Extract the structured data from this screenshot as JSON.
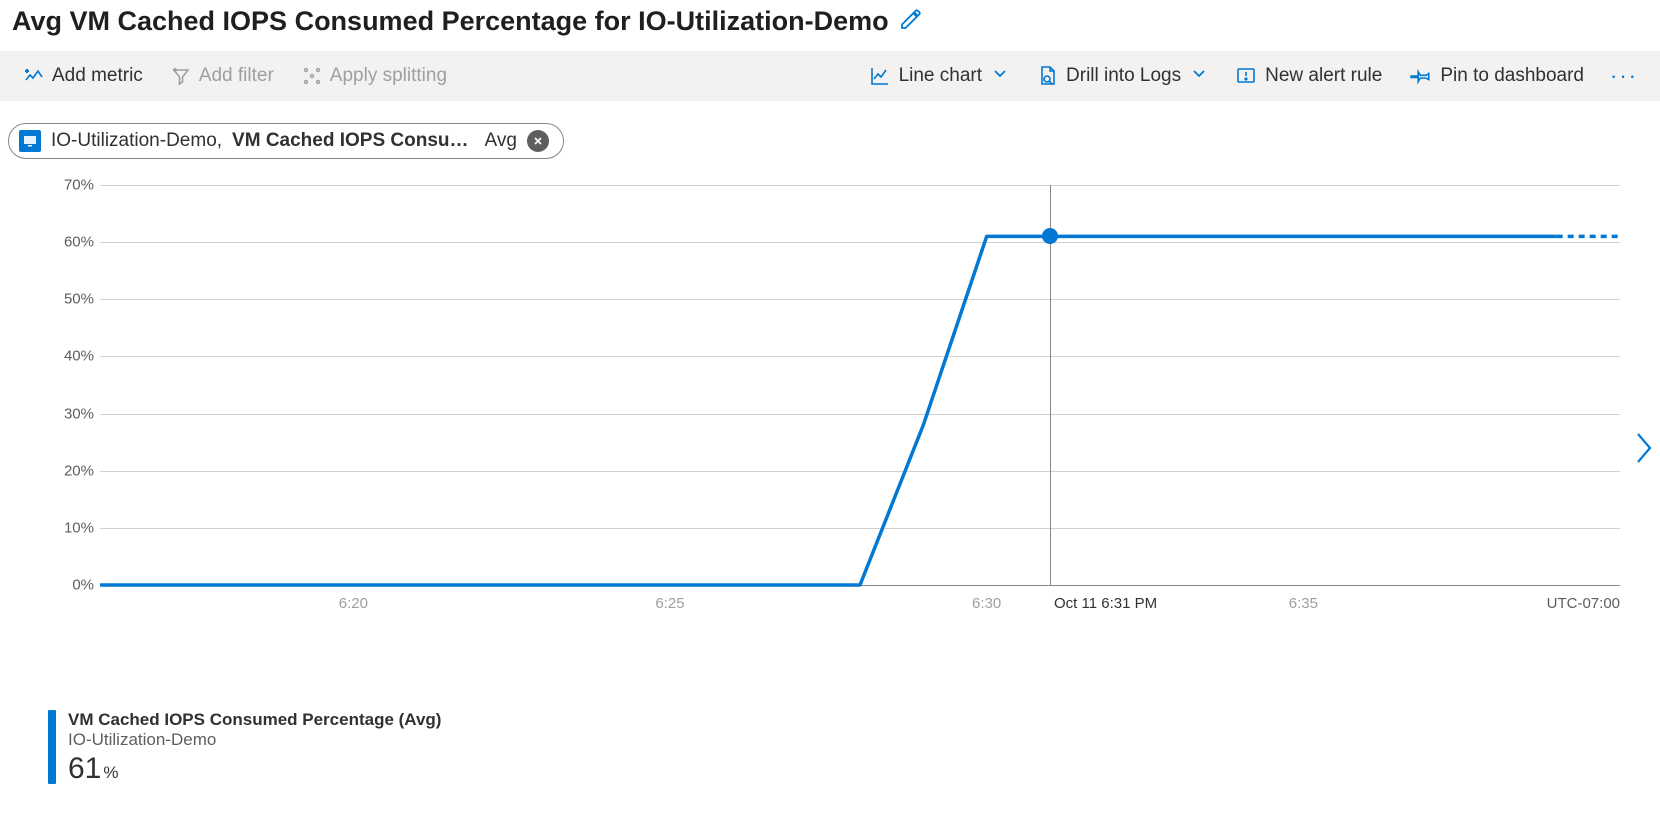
{
  "header": {
    "title": "Avg VM Cached IOPS Consumed Percentage for IO-Utilization-Demo"
  },
  "toolbar": {
    "add_metric": "Add metric",
    "add_filter": "Add filter",
    "apply_splitting": "Apply splitting",
    "chart_type": "Line chart",
    "drill_logs": "Drill into Logs",
    "new_alert": "New alert rule",
    "pin_dashboard": "Pin to dashboard"
  },
  "pill": {
    "resource": "IO-Utilization-Demo,",
    "metric": "VM Cached IOPS Consu…",
    "agg": "Avg"
  },
  "chart": {
    "y_ticks": [
      "0%",
      "10%",
      "20%",
      "30%",
      "40%",
      "50%",
      "60%",
      "70%"
    ],
    "x_ticks": [
      "6:20",
      "6:25",
      "6:30",
      "6:35"
    ],
    "timezone": "UTC-07:00",
    "hover_time": "Oct 11 6:31 PM"
  },
  "legend": {
    "series_name": "VM Cached IOPS Consumed Percentage (Avg)",
    "resource": "IO-Utilization-Demo",
    "value": "61",
    "unit": "%"
  },
  "chart_data": {
    "type": "line",
    "title": "Avg VM Cached IOPS Consumed Percentage for IO-Utilization-Demo",
    "xlabel": "",
    "ylabel": "",
    "ylim": [
      0,
      70
    ],
    "x_unit": "time (HH:MM)",
    "y_unit": "%",
    "categories": [
      "6:16",
      "6:17",
      "6:18",
      "6:19",
      "6:20",
      "6:21",
      "6:22",
      "6:23",
      "6:24",
      "6:25",
      "6:26",
      "6:27",
      "6:28",
      "6:29",
      "6:30",
      "6:31",
      "6:32",
      "6:33",
      "6:34",
      "6:35",
      "6:36",
      "6:37",
      "6:38",
      "6:39",
      "6:40"
    ],
    "series": [
      {
        "name": "VM Cached IOPS Consumed Percentage (Avg)",
        "resource": "IO-Utilization-Demo",
        "values": [
          0,
          0,
          0,
          0,
          0,
          0,
          0,
          0,
          0,
          0,
          0,
          0,
          0,
          28,
          61,
          61,
          61,
          61,
          61,
          61,
          61,
          61,
          61,
          61,
          61
        ]
      }
    ],
    "hover_point": {
      "x": "6:31",
      "y": 61
    },
    "timezone": "UTC-07:00"
  }
}
